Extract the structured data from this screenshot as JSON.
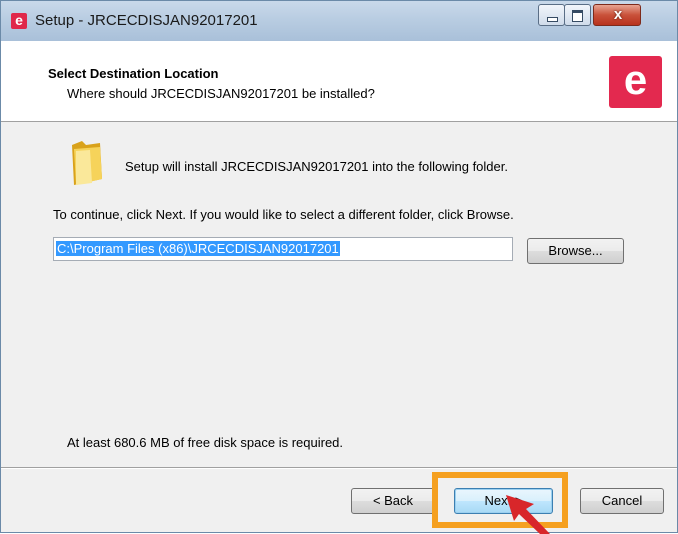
{
  "window": {
    "title": "Setup - JRCECDISJAN92017201",
    "app_icon_letter": "e",
    "close_glyph": "x"
  },
  "header": {
    "title": "Select Destination Location",
    "subtitle": "Where should JRCECDISJAN92017201 be installed?",
    "logo_letter": "e",
    "logo_color": "#e3294f"
  },
  "body": {
    "install_text": "Setup will install JRCECDISJAN92017201 into the following folder.",
    "continue_text": "To continue, click Next. If you would like to select a different folder, click Browse.",
    "path_value": "C:\\Program Files (x86)\\JRCECDISJAN92017201",
    "browse_label": "Browse...",
    "disk_space_text": "At least 680.6 MB of free disk space is required."
  },
  "footer": {
    "back_label": "< Back",
    "next_label": "Next >",
    "cancel_label": "Cancel"
  },
  "annotation": {
    "highlight_color": "#f5a020",
    "arrow_color": "#d8262a"
  }
}
